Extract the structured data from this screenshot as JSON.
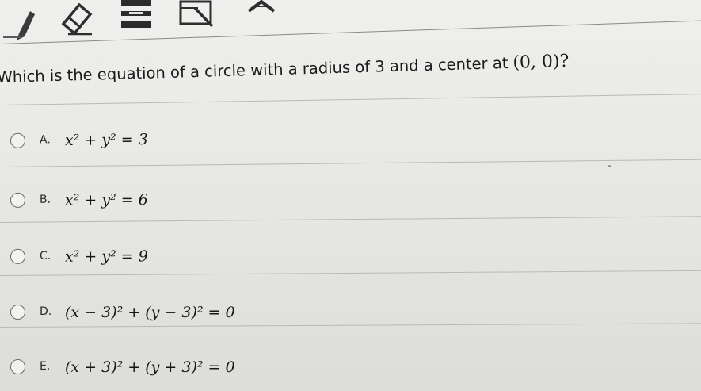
{
  "toolbar": {
    "tools": [
      {
        "name": "pencil-icon"
      },
      {
        "name": "eraser-icon"
      },
      {
        "name": "highlighter-icon"
      },
      {
        "name": "reference-card-icon"
      },
      {
        "name": "collapse-chevron-icon"
      }
    ]
  },
  "question": {
    "text": "Which is the equation of a circle with a radius of 3 and a center at",
    "point": "(0, 0)?"
  },
  "options": [
    {
      "letter": "A.",
      "equation": "x² + y² = 3"
    },
    {
      "letter": "B.",
      "equation": "x² + y² = 6"
    },
    {
      "letter": "C.",
      "equation": "x² + y² = 9"
    },
    {
      "letter": "D.",
      "equation": "(x − 3)² + (y − 3)² = 0"
    },
    {
      "letter": "E.",
      "equation": "(x + 3)² + (y + 3)² = 0"
    }
  ],
  "colors": {
    "background": "#e8e8e6",
    "text": "#1a1a1a",
    "divider": "#b9b9b7",
    "radio_border": "#6a6a6a"
  }
}
